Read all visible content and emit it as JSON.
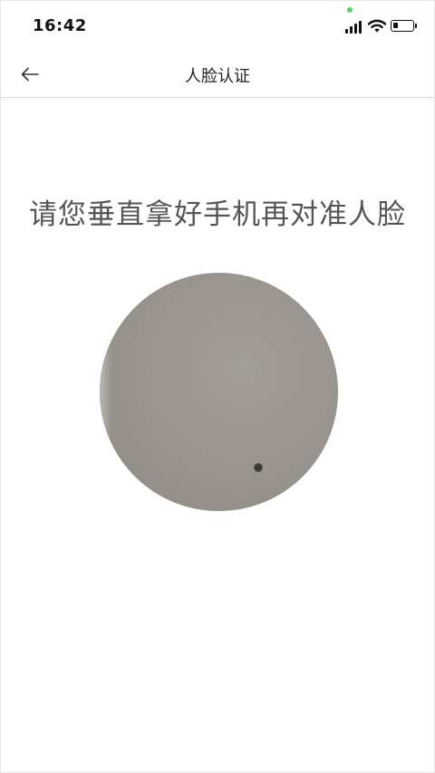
{
  "status_bar": {
    "time": "16:42",
    "icons": [
      "signal-icon",
      "wifi-icon",
      "battery-icon"
    ],
    "indicator_color": "#4cd964"
  },
  "nav": {
    "title": "人脸认证",
    "back_icon": "arrow-left-icon"
  },
  "main": {
    "instruction": "请您垂直拿好手机再对准人脸"
  },
  "colors": {
    "background": "#ffffff",
    "instruction_text": "#555555",
    "divider": "#dcdcdc"
  }
}
